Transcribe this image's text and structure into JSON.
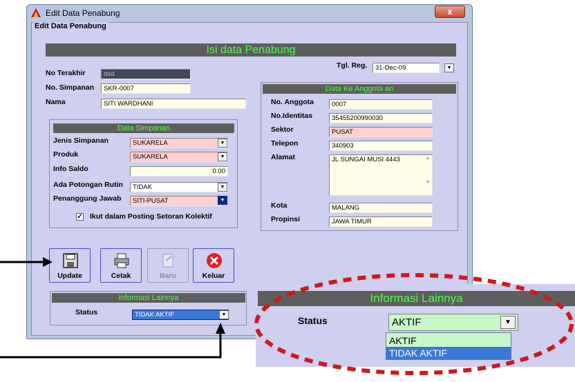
{
  "window": {
    "title": "Edit Data Penabung",
    "group_label": "Edit Data Penabung",
    "close_symbol": "x"
  },
  "banner": "Isi data Penabung",
  "left": {
    "no_terakhir": {
      "label": "No Terakhir",
      "value": "dsd"
    },
    "no_simpanan": {
      "label": "No. Simpanan",
      "value": "SKR-0007"
    },
    "nama": {
      "label": "Nama",
      "value": "SITI WARDHANI"
    }
  },
  "tgl_reg": {
    "label": "Tgl. Reg.",
    "value": "31-Dec-09"
  },
  "data_simpanan": {
    "title": "Data Simpanan",
    "jenis": {
      "label": "Jenis Simpanan",
      "value": "SUKARELA"
    },
    "produk": {
      "label": "Produk",
      "value": "SUKARELA"
    },
    "info_saldo": {
      "label": "Info Saldo",
      "value": "0.00"
    },
    "potongan": {
      "label": "Ada Potongan Rutin",
      "value": "TIDAK"
    },
    "penanggung": {
      "label": "Penanggung Jawab",
      "value": "SITI-PUSAT"
    },
    "ikut": {
      "label": "Ikut dalam Posting Setoran Kolektif",
      "checked": "✓"
    }
  },
  "anggota": {
    "title": "Data Ke Anggota an",
    "no_anggota": {
      "label": "No. Anggota",
      "value": "0007"
    },
    "identitas": {
      "label": "No.Identitas",
      "value": "35455200990030"
    },
    "sektor": {
      "label": "Sektor",
      "value": "PUSAT"
    },
    "telepon": {
      "label": "Telepon",
      "value": "340903"
    },
    "alamat": {
      "label": "Alamat",
      "value": "JL SUNGAI MUSI 4443"
    },
    "kota": {
      "label": "Kota",
      "value": "MALANG"
    },
    "propinsi": {
      "label": "Propinsi",
      "value": "JAWA TIMUR"
    }
  },
  "toolbar": {
    "update": "Update",
    "cetak": "Cetak",
    "baru": "Baru",
    "keluar": "Keluar"
  },
  "info": {
    "title": "Informasi Lainnya",
    "status_label": "Status",
    "status_value": "TIDAK AKTIF"
  },
  "zoom": {
    "title": "Informasi Lainnya",
    "status_label": "Status",
    "status_value": "AKTIF",
    "options": [
      "AKTIF",
      "TIDAK AKTIF"
    ],
    "selected_index": 1
  },
  "colors": {
    "banner_bg": "#5e5e5e",
    "banner_text": "#48ff48",
    "form_bg": "#cfcfef",
    "highlight_ring": "#cc1a1a"
  }
}
